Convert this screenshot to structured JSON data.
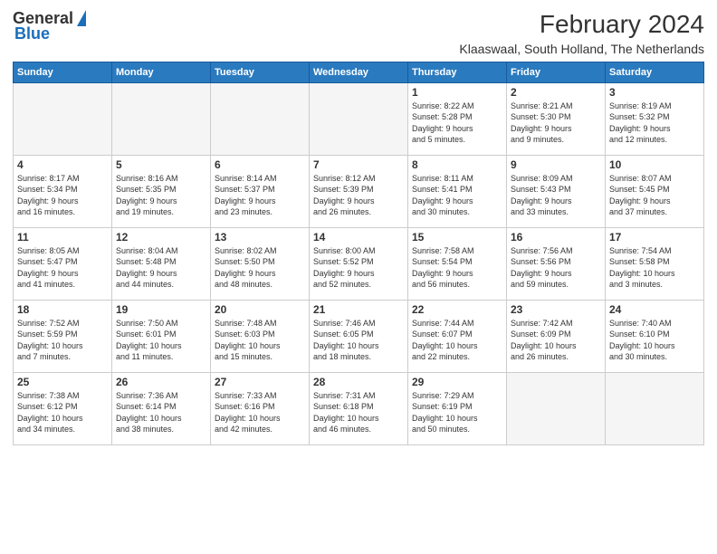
{
  "header": {
    "logo_general": "General",
    "logo_blue": "Blue",
    "title": "February 2024",
    "subtitle": "Klaaswaal, South Holland, The Netherlands"
  },
  "weekdays": [
    "Sunday",
    "Monday",
    "Tuesday",
    "Wednesday",
    "Thursday",
    "Friday",
    "Saturday"
  ],
  "weeks": [
    [
      {
        "day": "",
        "info": ""
      },
      {
        "day": "",
        "info": ""
      },
      {
        "day": "",
        "info": ""
      },
      {
        "day": "",
        "info": ""
      },
      {
        "day": "1",
        "info": "Sunrise: 8:22 AM\nSunset: 5:28 PM\nDaylight: 9 hours\nand 5 minutes."
      },
      {
        "day": "2",
        "info": "Sunrise: 8:21 AM\nSunset: 5:30 PM\nDaylight: 9 hours\nand 9 minutes."
      },
      {
        "day": "3",
        "info": "Sunrise: 8:19 AM\nSunset: 5:32 PM\nDaylight: 9 hours\nand 12 minutes."
      }
    ],
    [
      {
        "day": "4",
        "info": "Sunrise: 8:17 AM\nSunset: 5:34 PM\nDaylight: 9 hours\nand 16 minutes."
      },
      {
        "day": "5",
        "info": "Sunrise: 8:16 AM\nSunset: 5:35 PM\nDaylight: 9 hours\nand 19 minutes."
      },
      {
        "day": "6",
        "info": "Sunrise: 8:14 AM\nSunset: 5:37 PM\nDaylight: 9 hours\nand 23 minutes."
      },
      {
        "day": "7",
        "info": "Sunrise: 8:12 AM\nSunset: 5:39 PM\nDaylight: 9 hours\nand 26 minutes."
      },
      {
        "day": "8",
        "info": "Sunrise: 8:11 AM\nSunset: 5:41 PM\nDaylight: 9 hours\nand 30 minutes."
      },
      {
        "day": "9",
        "info": "Sunrise: 8:09 AM\nSunset: 5:43 PM\nDaylight: 9 hours\nand 33 minutes."
      },
      {
        "day": "10",
        "info": "Sunrise: 8:07 AM\nSunset: 5:45 PM\nDaylight: 9 hours\nand 37 minutes."
      }
    ],
    [
      {
        "day": "11",
        "info": "Sunrise: 8:05 AM\nSunset: 5:47 PM\nDaylight: 9 hours\nand 41 minutes."
      },
      {
        "day": "12",
        "info": "Sunrise: 8:04 AM\nSunset: 5:48 PM\nDaylight: 9 hours\nand 44 minutes."
      },
      {
        "day": "13",
        "info": "Sunrise: 8:02 AM\nSunset: 5:50 PM\nDaylight: 9 hours\nand 48 minutes."
      },
      {
        "day": "14",
        "info": "Sunrise: 8:00 AM\nSunset: 5:52 PM\nDaylight: 9 hours\nand 52 minutes."
      },
      {
        "day": "15",
        "info": "Sunrise: 7:58 AM\nSunset: 5:54 PM\nDaylight: 9 hours\nand 56 minutes."
      },
      {
        "day": "16",
        "info": "Sunrise: 7:56 AM\nSunset: 5:56 PM\nDaylight: 9 hours\nand 59 minutes."
      },
      {
        "day": "17",
        "info": "Sunrise: 7:54 AM\nSunset: 5:58 PM\nDaylight: 10 hours\nand 3 minutes."
      }
    ],
    [
      {
        "day": "18",
        "info": "Sunrise: 7:52 AM\nSunset: 5:59 PM\nDaylight: 10 hours\nand 7 minutes."
      },
      {
        "day": "19",
        "info": "Sunrise: 7:50 AM\nSunset: 6:01 PM\nDaylight: 10 hours\nand 11 minutes."
      },
      {
        "day": "20",
        "info": "Sunrise: 7:48 AM\nSunset: 6:03 PM\nDaylight: 10 hours\nand 15 minutes."
      },
      {
        "day": "21",
        "info": "Sunrise: 7:46 AM\nSunset: 6:05 PM\nDaylight: 10 hours\nand 18 minutes."
      },
      {
        "day": "22",
        "info": "Sunrise: 7:44 AM\nSunset: 6:07 PM\nDaylight: 10 hours\nand 22 minutes."
      },
      {
        "day": "23",
        "info": "Sunrise: 7:42 AM\nSunset: 6:09 PM\nDaylight: 10 hours\nand 26 minutes."
      },
      {
        "day": "24",
        "info": "Sunrise: 7:40 AM\nSunset: 6:10 PM\nDaylight: 10 hours\nand 30 minutes."
      }
    ],
    [
      {
        "day": "25",
        "info": "Sunrise: 7:38 AM\nSunset: 6:12 PM\nDaylight: 10 hours\nand 34 minutes."
      },
      {
        "day": "26",
        "info": "Sunrise: 7:36 AM\nSunset: 6:14 PM\nDaylight: 10 hours\nand 38 minutes."
      },
      {
        "day": "27",
        "info": "Sunrise: 7:33 AM\nSunset: 6:16 PM\nDaylight: 10 hours\nand 42 minutes."
      },
      {
        "day": "28",
        "info": "Sunrise: 7:31 AM\nSunset: 6:18 PM\nDaylight: 10 hours\nand 46 minutes."
      },
      {
        "day": "29",
        "info": "Sunrise: 7:29 AM\nSunset: 6:19 PM\nDaylight: 10 hours\nand 50 minutes."
      },
      {
        "day": "",
        "info": ""
      },
      {
        "day": "",
        "info": ""
      }
    ]
  ]
}
